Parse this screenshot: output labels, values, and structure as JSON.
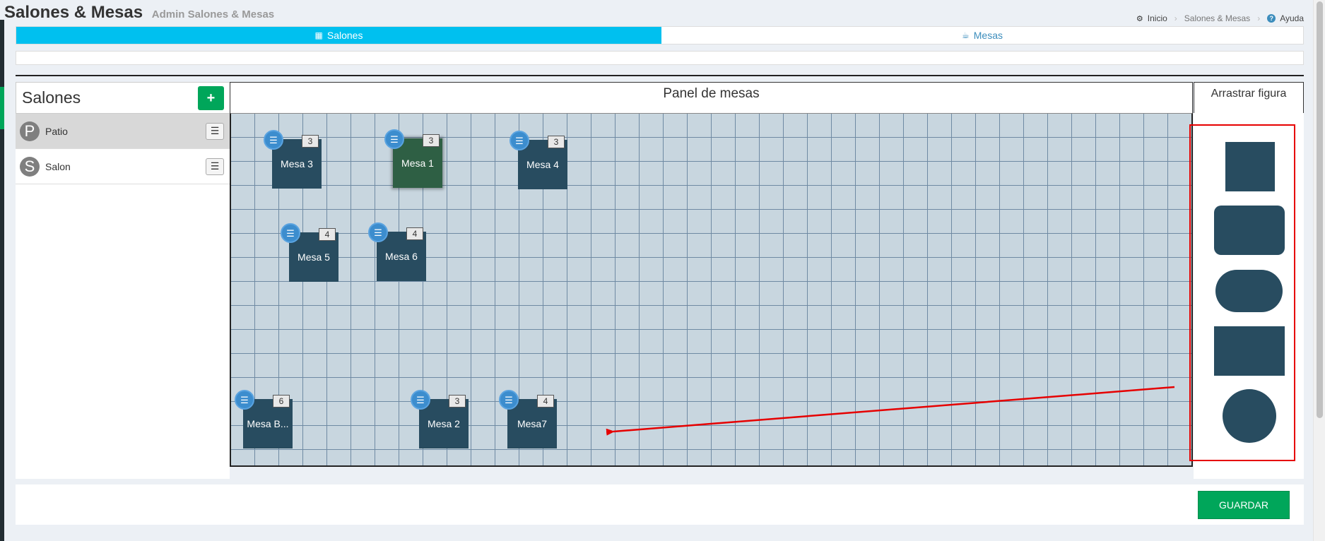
{
  "header": {
    "title": "Salones & Mesas",
    "subtitle": "Admin Salones & Mesas"
  },
  "breadcrumb": {
    "home": "Inicio",
    "current": "Salones & Mesas",
    "help": "Ayuda"
  },
  "tabs": [
    {
      "label": "Salones",
      "icon": "th-large-icon",
      "active": true
    },
    {
      "label": "Mesas",
      "icon": "coffee-icon",
      "active": false
    }
  ],
  "salones": {
    "title": "Salones",
    "add_label": "+",
    "items": [
      {
        "initial": "P",
        "name": "Patio",
        "selected": true
      },
      {
        "initial": "S",
        "name": "Salon",
        "selected": false
      }
    ]
  },
  "panel": {
    "title": "Panel de mesas",
    "mesas": [
      {
        "name": "Mesa 3",
        "count": "3",
        "active": false
      },
      {
        "name": "Mesa 1",
        "count": "3",
        "active": true
      },
      {
        "name": "Mesa 4",
        "count": "3",
        "active": false
      },
      {
        "name": "Mesa 5",
        "count": "4",
        "active": false
      },
      {
        "name": "Mesa 6",
        "count": "4",
        "active": false
      },
      {
        "name": "Mesa B...",
        "count": "6",
        "active": false
      },
      {
        "name": "Mesa 2",
        "count": "3",
        "active": false
      },
      {
        "name": "Mesa7",
        "count": "4",
        "active": false
      }
    ]
  },
  "figuras": {
    "title": "Arrastrar figura",
    "shapes": [
      "square-shape",
      "rounded-rectangle-shape",
      "pill-shape",
      "rectangle-shape",
      "circle-shape"
    ]
  },
  "footer": {
    "save_label": "GUARDAR"
  },
  "colors": {
    "tab_active": "#00c0ef",
    "success": "#00a65a",
    "mesa": "#284c60",
    "mesa_active": "#2e5f44",
    "annotation": "#e60000"
  }
}
